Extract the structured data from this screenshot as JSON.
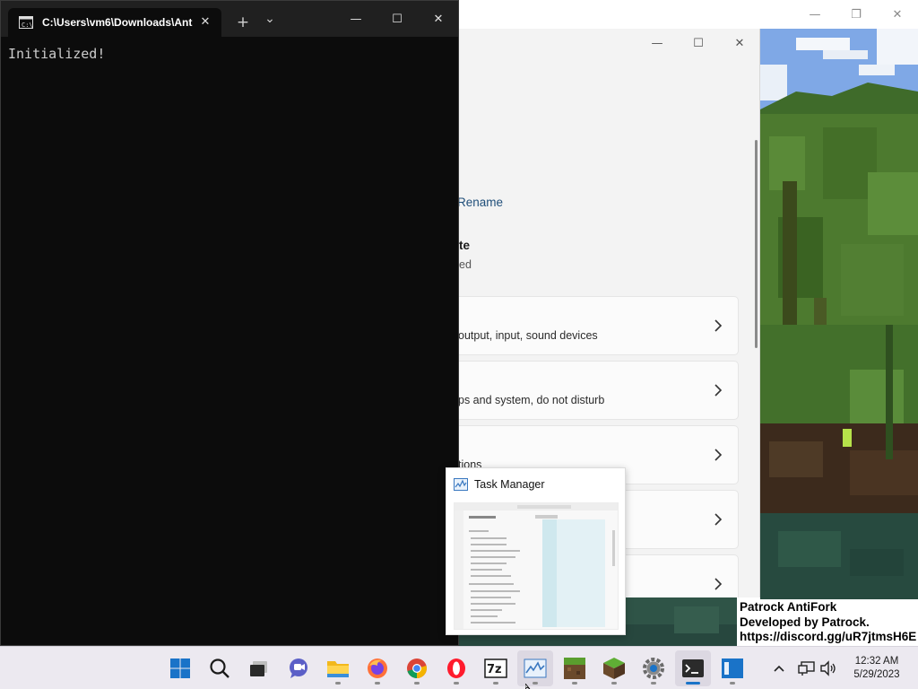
{
  "terminal": {
    "tab_title": "C:\\Users\\vm6\\Downloads\\Ant",
    "output": "Initialized!",
    "new_tab_glyph": "+",
    "dropdown_glyph": "⌄",
    "minimize_glyph": "—",
    "maximize_glyph": "☐",
    "close_glyph": "✕"
  },
  "settings": {
    "rename_link": "Rename",
    "heading_fragment": "te",
    "subheading_fragment": "ed",
    "cards": [
      {
        "desc": "output, input, sound devices"
      },
      {
        "desc": "ps and system, do not disturb"
      },
      {
        "desc": "tions"
      },
      {
        "desc": ""
      },
      {
        "desc": ""
      }
    ]
  },
  "game_overlay": {
    "line1": "Patrock AntiFork",
    "line2": "Developed by Patrock.",
    "line3": "https://discord.gg/uR7jtmsH6E"
  },
  "task_preview": {
    "title": "Task Manager"
  },
  "taskbar": {
    "apps": [
      {
        "name": "start-button-icon",
        "running": false
      },
      {
        "name": "search-icon",
        "running": false
      },
      {
        "name": "task-view-icon",
        "running": false
      },
      {
        "name": "teams-chat-icon",
        "running": false
      },
      {
        "name": "file-explorer-icon",
        "running": true
      },
      {
        "name": "firefox-icon",
        "running": true
      },
      {
        "name": "chrome-icon",
        "running": true
      },
      {
        "name": "opera-icon",
        "running": true
      },
      {
        "name": "7zip-icon",
        "running": true,
        "label": "7z"
      },
      {
        "name": "task-manager-icon",
        "running": true
      },
      {
        "name": "minecraft-launcher-icon",
        "running": true
      },
      {
        "name": "minecraft-icon",
        "running": true
      },
      {
        "name": "settings-icon",
        "running": true
      },
      {
        "name": "terminal-icon",
        "running": true,
        "focused": true
      },
      {
        "name": "remote-desktop-icon",
        "running": true
      }
    ],
    "time": "12:32 AM",
    "date": "5/29/2023"
  },
  "colors": {
    "taskbar": "#ece9f0",
    "terminal_bg": "#0c0c0c",
    "accent": "#1a73c8"
  }
}
